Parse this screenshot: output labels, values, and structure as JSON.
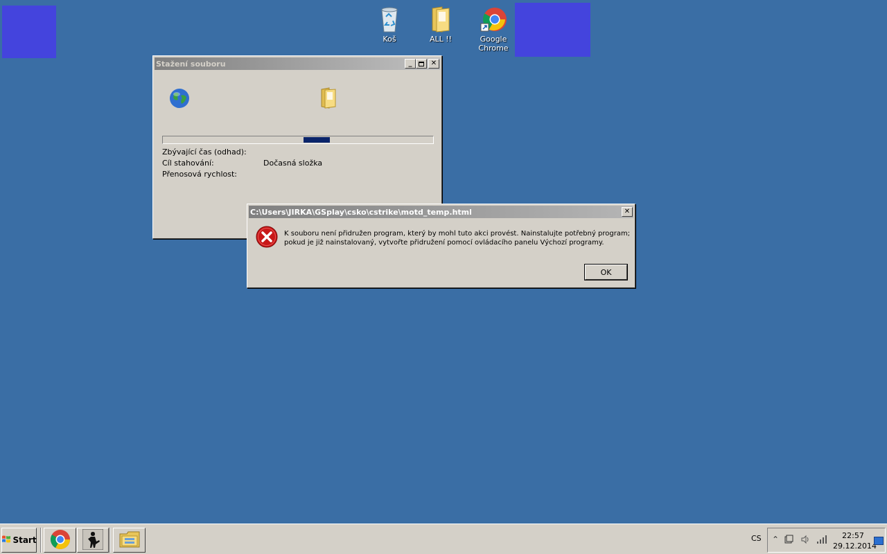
{
  "desktop": {
    "icons": [
      {
        "label": "Koš"
      },
      {
        "label": "ALL !!"
      },
      {
        "label": "Google\nChrome"
      }
    ]
  },
  "download_dialog": {
    "title": "Stažení souboru",
    "progress_value": 0.57,
    "rows": [
      {
        "label": "Zbývající čas (odhad):",
        "value": ""
      },
      {
        "label": "Cíl stahování:",
        "value": "Dočasná složka"
      },
      {
        "label": "Přenosová rychlost:",
        "value": ""
      }
    ]
  },
  "error_dialog": {
    "title": "C:\\Users\\JIRKA\\GSplay\\csko\\cstrike\\motd_temp.html",
    "message_line1": "K souboru není přidružen program, který by mohl tuto akci provést. Nainstalujte potřebný program;",
    "message_line2": "pokud je již nainstalovaný, vytvořte přidružení pomocí ovládacího panelu Výchozí programy.",
    "ok_label": "OK"
  },
  "taskbar": {
    "start_label": "Start",
    "language": "CS",
    "time": "22:57",
    "date": "29.12.2014"
  },
  "colors": {
    "desktop": "#3a6ea5",
    "desktop_block": "#4444dd",
    "progress_fill": "#0a246a",
    "error_red": "#c81818"
  }
}
